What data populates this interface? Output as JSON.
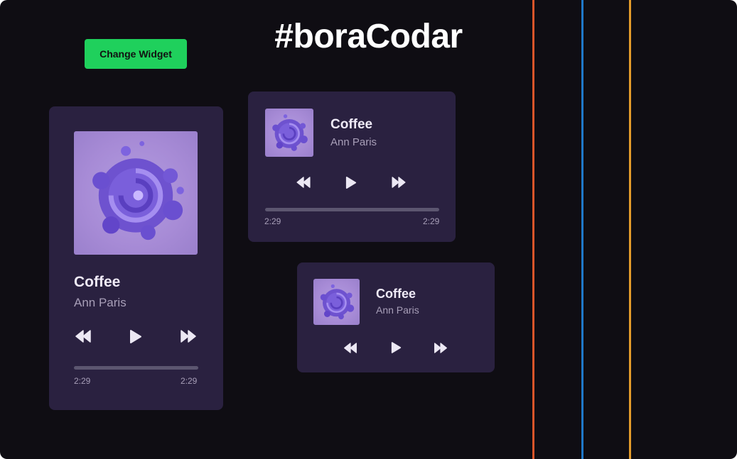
{
  "page": {
    "title": "#boraCodar",
    "change_widget_label": "Change Widget"
  },
  "colors": {
    "background": "#0f0d13",
    "card": "#2a2140",
    "accent_button": "#1fd05c",
    "line_red": "#d9552a",
    "line_blue": "#1f78c8",
    "line_orange": "#e39b2b"
  },
  "players": {
    "large": {
      "song": "Coffee",
      "artist": "Ann Paris",
      "current_time": "2:29",
      "total_time": "2:29"
    },
    "medium": {
      "song": "Coffee",
      "artist": "Ann Paris",
      "current_time": "2:29",
      "total_time": "2:29"
    },
    "small": {
      "song": "Coffee",
      "artist": "Ann Paris"
    }
  },
  "icons": [
    "album-art-icon",
    "rewind-icon",
    "play-icon",
    "fast-forward-icon"
  ]
}
